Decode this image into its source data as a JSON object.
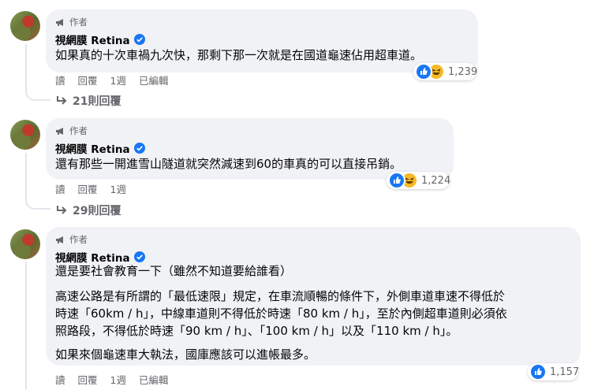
{
  "comments": [
    {
      "badge": "作者",
      "name": "視網膜 Retina",
      "text": "如果真的十次車禍九次快，那剩下那一次就是在國道龜速佔用超車道。",
      "actions": {
        "reply_label": "讀",
        "reply_btn": "回覆",
        "time": "1週",
        "edited": "已編輯"
      },
      "reaction_count": "1,239",
      "replies_label": "21則回覆"
    },
    {
      "badge": "作者",
      "name": "視網膜 Retina",
      "text": "還有那些一開進雪山隧道就突然減速到60的車真的可以直接吊銷。",
      "actions": {
        "reply_label": "讀",
        "reply_btn": "回覆",
        "time": "1週"
      },
      "reaction_count": "1,224",
      "replies_label": "29則回覆"
    },
    {
      "badge": "作者",
      "name": "視網膜 Retina",
      "paragraphs": [
        "還是要社會教育一下（雖然不知道要給誰看）",
        "高速公路是有所謂的「最低速限」規定，在車流順暢的條件下，外側車道車速不得低於",
        "時速「60km / h」，中線車道則不得低於時速「80 km / h」，至於內側超車道則必須依",
        "照路段，不得低於時速「90 km / h」、「100 km / h」以及「110 km / h」。",
        "如果來個龜速車大執法，國庫應該可以進帳最多。"
      ],
      "actions": {
        "reply_label": "讀",
        "reply_btn": "回覆",
        "time": "1週",
        "edited": "已編輯"
      },
      "reaction_count": "1,157"
    }
  ]
}
